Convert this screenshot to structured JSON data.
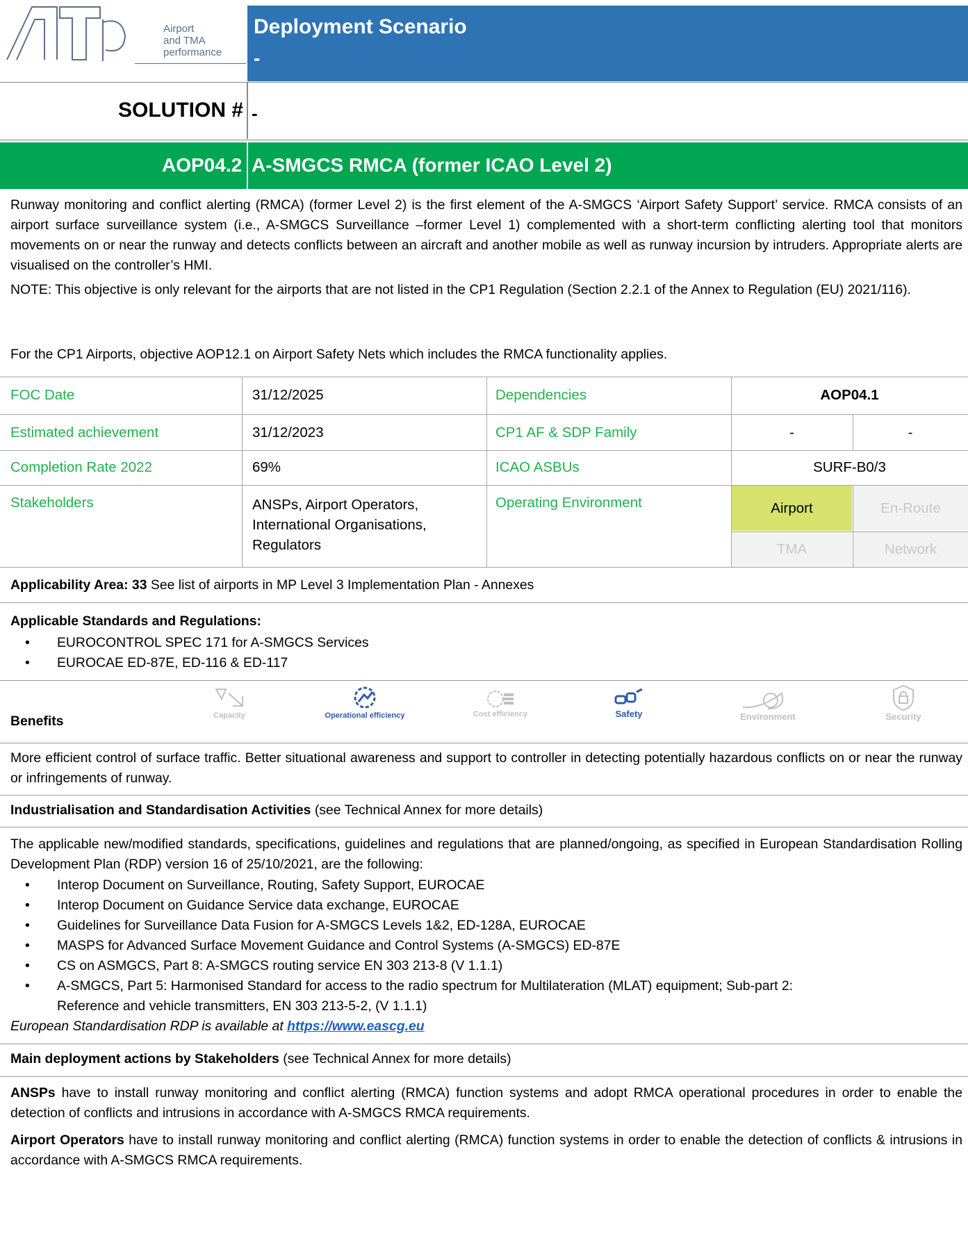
{
  "header": {
    "logo_mark": "ATp",
    "logo_lines": [
      "Airport",
      "and TMA",
      "performance"
    ],
    "title": "Deployment Scenario",
    "title_sub": "-",
    "solution_label": "SOLUTION #",
    "solution_value": "-",
    "objective_code": "AOP04.2",
    "objective_title": "A-SMGCS RMCA (former ICAO Level 2)"
  },
  "description": {
    "p1": "Runway monitoring and conflict alerting (RMCA) (former Level 2) is the first element of the A-SMGCS ‘Airport Safety Support’ service. RMCA consists of an airport surface surveillance system (i.e., A-SMGCS Surveillance –former Level 1) complemented with a short-term conflicting alerting tool that monitors movements on or near the runway and detects conflicts between an aircraft and another mobile as well as runway incursion by intruders. Appropriate alerts are visualised on the controller’s HMI.",
    "p2": "NOTE: This objective is only relevant for the airports that are not listed in the CP1 Regulation (Section 2.2.1 of the Annex to Regulation (EU) 2021/116).",
    "p3": "For the CP1 Airports, objective AOP12.1 on Airport Safety Nets which includes the RMCA functionality applies."
  },
  "info": {
    "foc_label": "FOC Date",
    "foc_value": "31/12/2025",
    "dep_label": "Dependencies",
    "dep_value": "AOP04.1",
    "est_label": "Estimated achievement",
    "est_value": "31/12/2023",
    "cp1_label": "CP1 AF & SDP Family",
    "cp1_value_1": "-",
    "cp1_value_2": "-",
    "comp_label": "Completion Rate 2022",
    "comp_value": "69%",
    "asbu_label": "ICAO ASBUs",
    "asbu_value": "SURF-B0/3",
    "stake_label": "Stakeholders",
    "stake_value": "ANSPs, Airport Operators, International Organisations, Regulators",
    "env_label": "Operating Environment",
    "env_airport": "Airport",
    "env_enroute": "En-Route",
    "env_tma": "TMA",
    "env_network": "Network",
    "active_color": "#d6e26b"
  },
  "applicability": {
    "label": "Applicability Area:",
    "count": "33",
    "text": "See list of airports in MP Level 3 Implementation Plan - Annexes"
  },
  "standards": {
    "title": "Applicable Standards and Regulations:",
    "items": [
      "EUROCONTROL SPEC 171 for A-SMGCS Services",
      "EUROCAE ED-87E, ED-116 & ED-117"
    ]
  },
  "benefits": {
    "label": "Benefits",
    "icons": [
      {
        "name": "Capacity",
        "active": false
      },
      {
        "name": "Operational efficiency",
        "active": true
      },
      {
        "name": "Cost efficiency",
        "active": false
      },
      {
        "name": "Safety",
        "active": true
      },
      {
        "name": "Environment",
        "active": false
      },
      {
        "name": "Security",
        "active": false
      }
    ],
    "text": "More efficient control of surface traffic. Better situational awareness and support to controller in detecting potentially hazardous conflicts on or near the runway or infringements of runway."
  },
  "industrialisation": {
    "title": "Industrialisation and Standardisation Activities",
    "note": "(see Technical Annex for more details)",
    "intro": "The applicable new/modified standards, specifications, guidelines and regulations that are planned/ongoing, as specified in European Standardisation Rolling Development Plan (RDP) version 16 of 25/10/2021, are the following:",
    "items": [
      "Interop Document on Surveillance, Routing, Safety Support, EUROCAE",
      "Interop Document on  Guidance Service data exchange, EUROCAE",
      "Guidelines for Surveillance Data Fusion for A-SMGCS Levels 1&2, ED-128A, EUROCAE",
      "MASPS for Advanced Surface Movement Guidance and Control Systems (A-SMGCS) ED-87E",
      "CS on ASMGCS, Part 8: A-SMGCS routing service EN 303 213-8 (V 1.1.1)",
      "A-SMGCS,  Part 5: Harmonised Standard for access to the radio spectrum for Multilateration (MLAT) equipment; Sub-part 2: Reference and vehicle transmitters, EN 303 213-5-2, (V 1.1.1)"
    ],
    "rdp_note": "European Standardisation RDP is available at",
    "rdp_link": "https://www.eascg.eu"
  },
  "actions": {
    "title": "Main deployment actions by Stakeholders",
    "note": "(see Technical Annex for more details)",
    "ansp_label": "ANSPs",
    "ansp_text": "have to install runway monitoring and conflict alerting (RMCA) function systems and adopt RMCA operational procedures in order to enable the detection of conflicts and intrusions in accordance with A-SMGCS RMCA requirements.",
    "apt_label": "Airport Operators",
    "apt_text": "have to install runway monitoring and conflict alerting (RMCA) function systems in order to enable the detection of conflicts & intrusions in accordance with A-SMGCS RMCA requirements."
  }
}
